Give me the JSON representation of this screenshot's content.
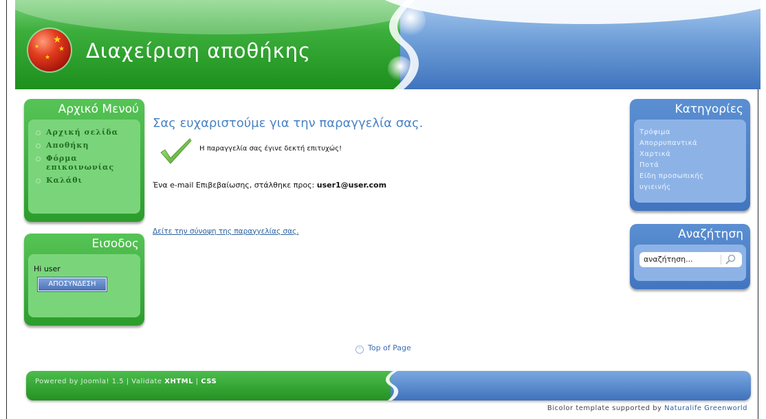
{
  "site": {
    "title": "Διαχείριση αποθήκης"
  },
  "left_menu": {
    "title": "Αρχικό Μενού",
    "items": [
      {
        "label": "Αρχική σελίδα"
      },
      {
        "label": "Αποθήκη"
      },
      {
        "label": "Φόρμα επικοινωνίας"
      },
      {
        "label": "Καλάθι"
      }
    ]
  },
  "login": {
    "title": "Εισοδος",
    "greeting": "Hi user",
    "logout_label": "ΑΠΟΣΥΝΔΕΣΗ"
  },
  "main": {
    "heading": "Σας ευχαριστούμε για την παραγγελία σας.",
    "success_message": "Η παραγγελία σας έγινε δεκτή επιτυχώς!",
    "email_prefix": "Ένα e-mail Επιβεβαίωσης, στάλθηκε προς: ",
    "email_address": "user1@user.com",
    "summary_link": "Δείτε την σύνοψη της παραγγελίας σας.",
    "top_of_page": "Top of Page"
  },
  "categories": {
    "title": "Κατηγορίες",
    "items": [
      {
        "label": "Τρόφιμα"
      },
      {
        "label": "Απορρυπαντικά"
      },
      {
        "label": "Χαρτικά"
      },
      {
        "label": "Ποτά"
      },
      {
        "label": "Είδη προσωπικής υγιεινής"
      }
    ]
  },
  "search": {
    "title": "Αναζήτηση",
    "value": "αναζήτηση..."
  },
  "footer": {
    "powered_prefix": "Powered by Joomla! 1.5 | Validate ",
    "xhtml": "XHTML",
    "separator": " | ",
    "css": "CSS",
    "credit_prefix": "Bicolor template supported by ",
    "credit_link": "Naturalife Greenworld"
  },
  "colors": {
    "green": "#2b9d2b",
    "blue": "#4175bf",
    "heading": "#4a82c4"
  }
}
